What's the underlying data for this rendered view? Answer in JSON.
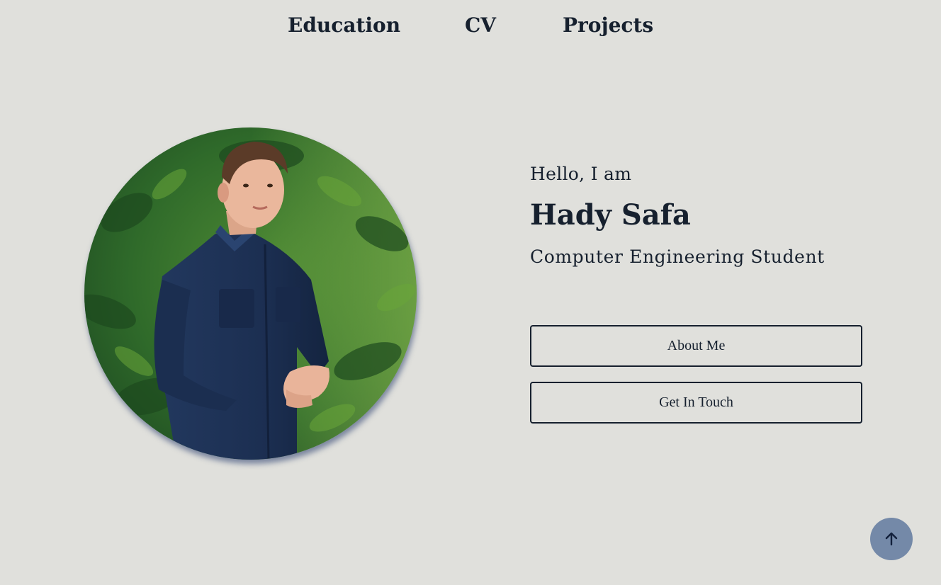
{
  "nav": {
    "items": [
      {
        "label": "Education"
      },
      {
        "label": "CV"
      },
      {
        "label": "Projects"
      }
    ]
  },
  "profile": {
    "photo_icon": "profile-photo",
    "greeting": "Hello, I am",
    "name": "Hady Safa",
    "role": "Computer Engineering Student"
  },
  "actions": {
    "about_label": "About Me",
    "contact_label": "Get In Touch"
  },
  "scroll_top": {
    "icon": "arrow-up-icon"
  },
  "colors": {
    "background": "#e0e0dc",
    "text": "#16202e",
    "scroll_button": "#7489a8",
    "shirt": "#1f355a",
    "foliage": "#2f6a2a"
  }
}
